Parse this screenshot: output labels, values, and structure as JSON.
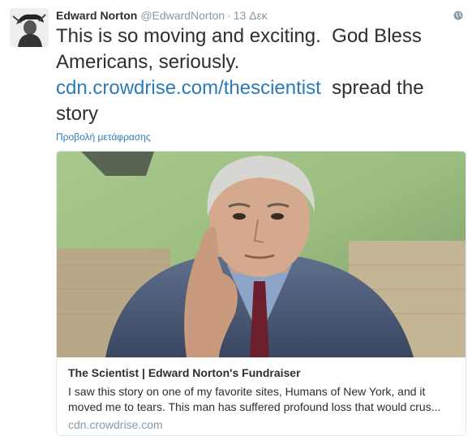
{
  "user": {
    "fullname": "Edward Norton",
    "username": "@EdwardNorton",
    "separator": "·",
    "timestamp": "13 Δεκ"
  },
  "tweet": {
    "text_before": "This is so moving and exciting.  God Bless Americans, seriously.\n",
    "link": "cdn.crowdrise.com/thescientist",
    "text_after": "  spread the story"
  },
  "translate_label": "Προβολή μετάφρασης",
  "card": {
    "title": "The Scientist | Edward Norton's Fundraiser",
    "description": "I saw this story on one of my favorite sites, Humans of New York, and it moved me to tears. This man has suffered profound loss that would crus...",
    "domain": "cdn.crowdrise.com"
  },
  "icons": {
    "globe": "globe-icon",
    "avatar": "avatar-image"
  },
  "colors": {
    "link": "#2b7bb9",
    "muted": "#8899a6",
    "text": "#292f33"
  }
}
